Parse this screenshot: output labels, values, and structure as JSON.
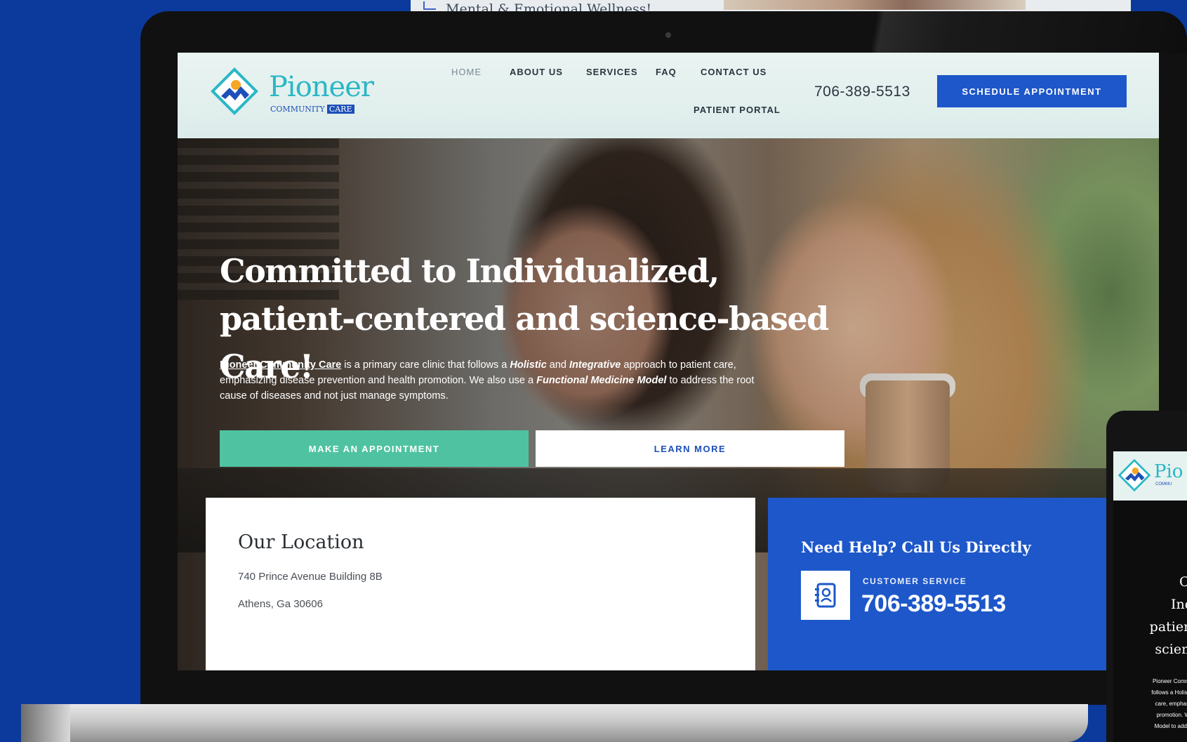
{
  "backdrop": {
    "partial_text": "Mental & Emotional Wellness!"
  },
  "site": {
    "logo": {
      "word": "Pioneer",
      "sub": "COMMUNITY",
      "sub_badge": "CARE"
    },
    "nav": {
      "items": [
        {
          "label": "HOME",
          "active": true
        },
        {
          "label": "ABOUT US",
          "active": false
        },
        {
          "label": "SERVICES",
          "active": false
        },
        {
          "label": "FAQ",
          "active": false
        },
        {
          "label": "CONTACT US",
          "active": false
        },
        {
          "label": "PATIENT PORTAL",
          "active": false
        }
      ]
    },
    "header_phone": "706-389-5513",
    "schedule_button": "SCHEDULE APPOINTMENT",
    "hero": {
      "title_line1": "Committed to Individualized,",
      "title_line2": "patient-centered and science-based Care!",
      "body": {
        "brand_link": "Pioneer Community Care",
        "part1": " is a primary care clinic that follows a ",
        "holistic": "Holistic",
        "and": " and ",
        "integrative": "Integrative",
        "part2": " approach to patient care, emphasizing disease prevention and health promotion. We also use a ",
        "functional": "Functional Medicine Model",
        "part3": " to address the root cause of diseases and not just manage symptoms."
      },
      "primary_button": "MAKE AN APPOINTMENT",
      "secondary_button": "LEARN MORE"
    },
    "location": {
      "title": "Our Location",
      "address_line1": "740 Prince Avenue Building 8B",
      "address_line2": "Athens, Ga 30606"
    },
    "help": {
      "title": "Need Help? Call Us Directly",
      "label": "CUSTOMER SERVICE",
      "phone": "706-389-5513"
    }
  },
  "mobile": {
    "logo_word": "Pio",
    "logo_sub": "COMMU",
    "title_lines": [
      "Co",
      "Indi",
      "patient",
      "scienc"
    ],
    "body_lines": [
      "Pioneer Communi",
      "follows a Holistic a",
      "care, emphasizin",
      "promotion. We a",
      "Model to address"
    ]
  },
  "colors": {
    "brand_blue": "#1d57c9",
    "brand_teal": "#2ab7c6",
    "cta_green": "#4fc3a1",
    "background": "#0b3a9c"
  }
}
